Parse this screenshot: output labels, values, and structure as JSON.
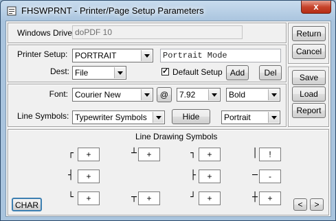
{
  "window": {
    "title": "FHSWPRNT - Printer/Page Setup Parameters",
    "close_label": "x"
  },
  "driver": {
    "label": "Windows Driver:",
    "value": "doPDF 10"
  },
  "printer": {
    "setup_label": "Printer Setup:",
    "setup_value": "PORTRAIT",
    "description": "Portrait Mode",
    "dest_label": "Dest:",
    "dest_value": "File",
    "default_label": "Default Setup",
    "add_label": "Add",
    "del_label": "Del"
  },
  "font": {
    "label": "Font:",
    "name": "Courier New",
    "at_label": "@",
    "size": "7.92",
    "style": "Bold",
    "line_symbols_label": "Line Symbols:",
    "line_symbols_value": "Typewriter Symbols",
    "hide_label": "Hide",
    "orientation": "Portrait"
  },
  "side_buttons": {
    "return": "Return",
    "cancel": "Cancel",
    "save": "Save",
    "load": "Load",
    "report": "Report"
  },
  "line_drawing": {
    "title": "Line Drawing Symbols",
    "rows": [
      [
        {
          "glyph": "┌",
          "value": "+"
        },
        {
          "glyph": "┴",
          "value": "+"
        },
        {
          "glyph": "┐",
          "value": "+"
        },
        {
          "glyph": "│",
          "value": "!"
        }
      ],
      [
        {
          "glyph": "┤",
          "value": "+"
        },
        {
          "glyph": "",
          "value": ""
        },
        {
          "glyph": "├",
          "value": "+"
        },
        {
          "glyph": "─",
          "value": "-"
        }
      ],
      [
        {
          "glyph": "└",
          "value": "+"
        },
        {
          "glyph": "┬",
          "value": "+"
        },
        {
          "glyph": "┘",
          "value": "+"
        },
        {
          "glyph": "┼",
          "value": "+"
        }
      ]
    ],
    "char_button": "CHAR",
    "prev_label": "<",
    "next_label": ">"
  }
}
